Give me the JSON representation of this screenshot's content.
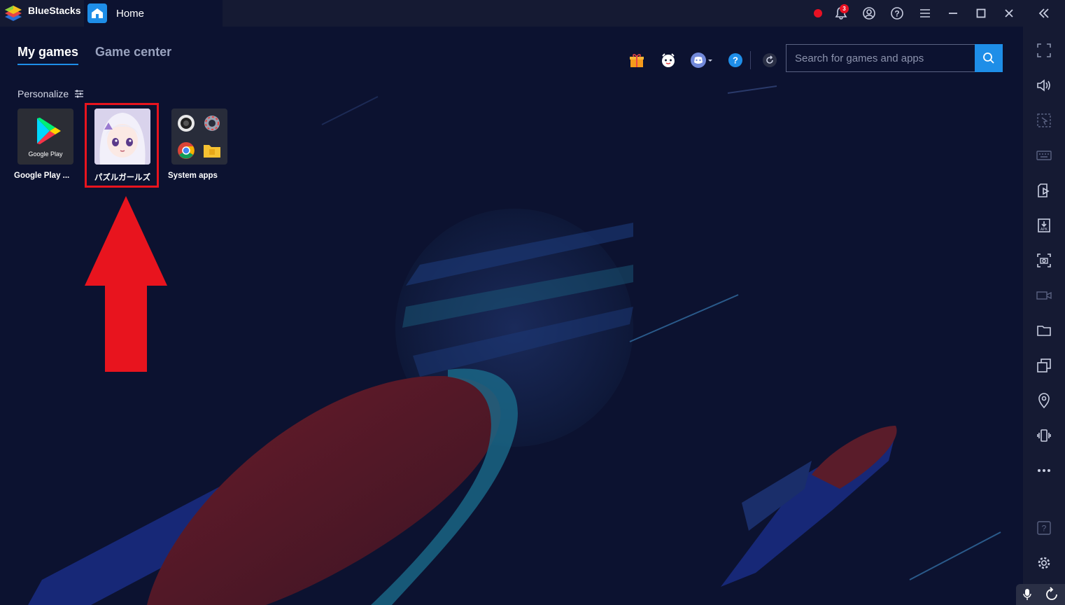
{
  "app": {
    "name": "BlueStacks"
  },
  "tab": {
    "label": "Home"
  },
  "titlebar": {
    "notification_count": "3"
  },
  "nav": {
    "my_games": "My games",
    "game_center": "Game center"
  },
  "search": {
    "placeholder": "Search for games and apps"
  },
  "personalize": {
    "label": "Personalize"
  },
  "games": [
    {
      "label": "Google Play ...",
      "icon_text": "Google Play"
    },
    {
      "label": "パズルガールズ"
    },
    {
      "label": "System apps"
    }
  ],
  "colors": {
    "accent": "#1e8ee8",
    "highlight": "#e8141e",
    "background": "#0c1230",
    "titlebar": "#151a33"
  }
}
